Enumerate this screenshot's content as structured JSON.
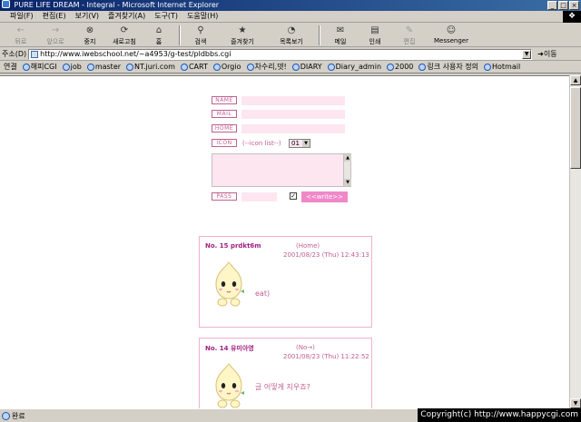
{
  "window": {
    "title": "PURE LIFE DREAM - Integral - Microsoft Internet Explorer",
    "controls": {
      "minimize": "_",
      "maximize": "□",
      "close": "×"
    }
  },
  "menu": [
    "파일(F)",
    "편집(E)",
    "보기(V)",
    "즐겨찾기(A)",
    "도구(T)",
    "도움말(H)"
  ],
  "toolbar": {
    "back": "뒤로",
    "forward": "앞으로",
    "stop": "중지",
    "refresh": "새로고침",
    "home": "홈",
    "search": "검색",
    "favorites": "즐겨찾기",
    "history": "목록보기",
    "mail": "메일",
    "print": "인쇄",
    "edit": "편집",
    "messenger": "Messenger"
  },
  "address": {
    "label": "주소(D)",
    "url": "http://www.iwebschool.net/~a4953/g-test/pldbbs.cgi",
    "go": "이동"
  },
  "links": {
    "label": "연결",
    "items": [
      "해피CGI",
      "job",
      "master",
      "NT.juri.com",
      "CART",
      "Orgio",
      "차수리,뎃!",
      "DIARY",
      "Diary_admin",
      "2000",
      "링크 사용자 정의",
      "Hotmail"
    ]
  },
  "form": {
    "name_label": "NAME",
    "mail_label": "MAIL",
    "home_label": "HOME",
    "icon_label": "ICON",
    "icon_list_text": "(--icon list--)",
    "icon_selected": "01",
    "pass_label": "PASS",
    "checkbox_mark": "✓",
    "write_button": "<<write>>"
  },
  "posts": [
    {
      "number": "No. 15 prdkt6m",
      "home": "(Home)",
      "date": "2001/08/23 (Thu) 12:43:13",
      "message": "eat)"
    },
    {
      "number": "No. 14 유미아영",
      "home": "(No→)",
      "date": "2001/08/23 (Thu) 11:22:52",
      "message": "글 어떻게 지우죠?"
    }
  ],
  "status": {
    "text": "완료",
    "copyright": "Copyright(c) http://www.happycgi.com"
  },
  "colors": {
    "accent_pink": "#f088c8",
    "label_pink": "#c06090",
    "input_bg": "#fde6f0",
    "post_border": "#f0b0d0"
  }
}
